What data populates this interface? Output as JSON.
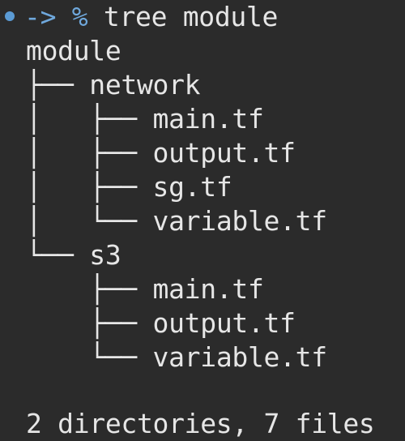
{
  "prompt": {
    "arrow": "->",
    "symbol": "%",
    "command": "tree module"
  },
  "tree": {
    "root": "module",
    "lines": [
      {
        "prefix": "├── ",
        "name": "network"
      },
      {
        "prefix": "│   ├── ",
        "name": "main.tf"
      },
      {
        "prefix": "│   ├── ",
        "name": "output.tf"
      },
      {
        "prefix": "│   ├── ",
        "name": "sg.tf"
      },
      {
        "prefix": "│   └── ",
        "name": "variable.tf"
      },
      {
        "prefix": "└── ",
        "name": "s3"
      },
      {
        "prefix": "    ├── ",
        "name": "main.tf"
      },
      {
        "prefix": "    ├── ",
        "name": "output.tf"
      },
      {
        "prefix": "    └── ",
        "name": "variable.tf"
      }
    ]
  },
  "summary": "2 directories, 7 files",
  "colors": {
    "background": "#2b2b2b",
    "prompt_accent": "#6fa8dc",
    "text": "#e6e6e6"
  }
}
